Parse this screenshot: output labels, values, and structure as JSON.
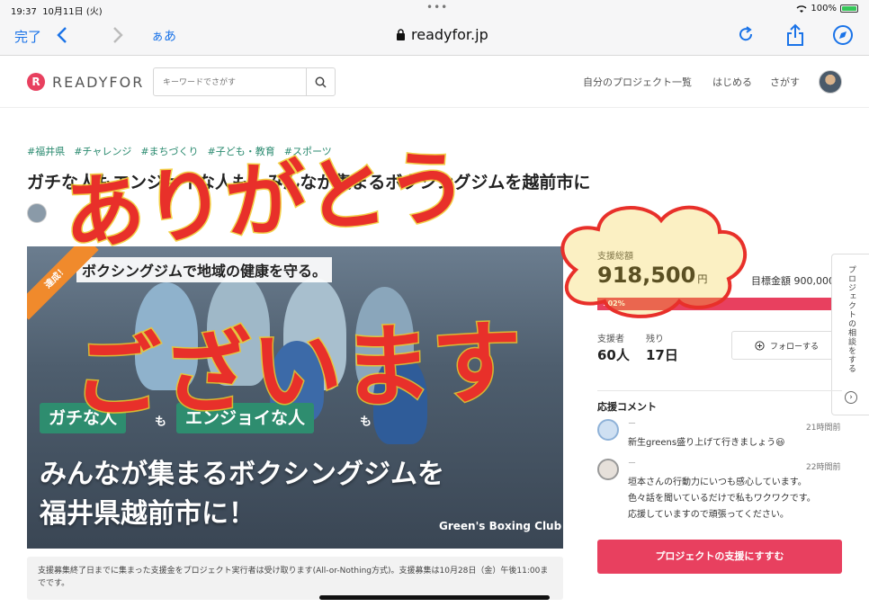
{
  "status_bar": {
    "time": "19:37",
    "date": "10月11日 (火)",
    "battery": "100%"
  },
  "browser": {
    "done_label": "完了",
    "text_size_label": "ぁあ",
    "url": "readyfor.jp",
    "icons": {
      "lock": "lock-icon",
      "reload": "reload-icon",
      "share": "share-icon",
      "compass": "compass-icon"
    }
  },
  "header": {
    "logo_text": "READYFOR",
    "search_placeholder": "キーワードでさがす",
    "nav": [
      "自分のプロジェクト一覧",
      "はじめる",
      "さがす"
    ]
  },
  "project": {
    "tags": [
      "#福井県",
      "#チャレンジ",
      "#まちづくり",
      "#子ども・教育",
      "#スポーツ"
    ],
    "title": "ガチな人もエンジョイな人も、みんなが集まるボクシングジムを越前市に",
    "hero": {
      "ribbon": "達成！",
      "top_text": "ボクシングジムで地域の健康を守る。",
      "chip1": "ガチな人",
      "chip2": "エンジョイな人",
      "mo": "も",
      "line1": "みんなが集まるボクシングジムを",
      "line2": "福井県越前市に！",
      "club": "Green's Boxing Club"
    },
    "note": "支援募集終了日までに集まった支援金をプロジェクト実行者は受け取ります(All-or-Nothing方式)。支援募集は10月28日（金）午後11:00までです。"
  },
  "stats": {
    "total_label": "支援総額",
    "total_value": "918,500",
    "total_unit": "円",
    "goal_text": "目標金額 900,000",
    "progress_label": "102%",
    "progress_fraction": 1.0,
    "backers_label": "支援者",
    "backers_value": "60人",
    "remaining_label": "残り",
    "remaining_value": "17日",
    "follow_label": "フォローする"
  },
  "side_tab": {
    "label": "プロジェクトの相談をする"
  },
  "comments": {
    "heading": "応援コメント",
    "items": [
      {
        "name": "ー",
        "time": "21時間前",
        "text": [
          "新生greens盛り上げて行きましょう😃"
        ]
      },
      {
        "name": "ー",
        "time": "22時間前",
        "text": [
          "垣本さんの行動力にいつも感心しています。",
          "色々話を聞いているだけで私もワクワクです。",
          "応援していますので頑張ってください。"
        ]
      }
    ]
  },
  "cta_label": "プロジェクトの支援にすすむ",
  "handwriting": {
    "line1": "ありがとう",
    "line2": "ございます"
  },
  "colors": {
    "accent": "#e8405f",
    "tag_green": "#2a8a6f",
    "ios_blue": "#1a73e8",
    "hand_red": "#e8302a",
    "hand_yellow": "#f0c828"
  }
}
